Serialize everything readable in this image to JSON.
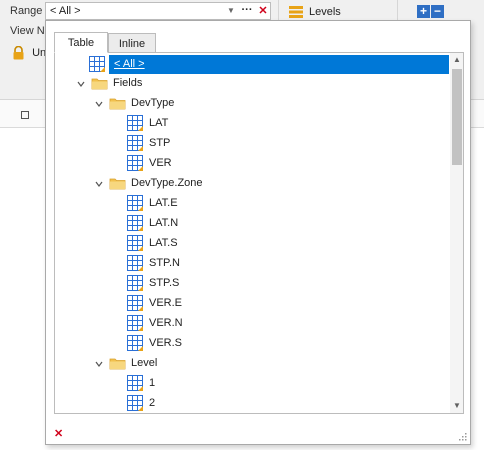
{
  "ribbon": {
    "range_label": "Range",
    "range_value": "< All >",
    "ellipsis": "···",
    "clear_glyph": "✕",
    "dropdown_glyph": "▼",
    "view_label": "View Ne",
    "lock_label": "Un",
    "levels_label": "Levels",
    "plus_glyph": "+",
    "minus_glyph": "−"
  },
  "popup": {
    "tabs": [
      {
        "label": "Table",
        "active": true
      },
      {
        "label": "Inline",
        "active": false
      }
    ],
    "tree": {
      "selected": {
        "label": "< All >"
      },
      "fields": {
        "label": "Fields",
        "groups": [
          {
            "label": "DevType",
            "items": [
              "LAT",
              "STP",
              "VER"
            ]
          },
          {
            "label": "DevType.Zone",
            "items": [
              "LAT.E",
              "LAT.N",
              "LAT.S",
              "STP.N",
              "STP.S",
              "VER.E",
              "VER.N",
              "VER.S"
            ]
          },
          {
            "label": "Level",
            "items": [
              "1",
              "2"
            ]
          }
        ]
      }
    },
    "scroll_up_glyph": "▲",
    "scroll_down_glyph": "▼",
    "footer_clear_glyph": "✕"
  },
  "colors": {
    "selection": "#0078d7",
    "folder": "#f2c14e",
    "table_icon": "#2a6fd6",
    "clear": "#d0021b"
  }
}
